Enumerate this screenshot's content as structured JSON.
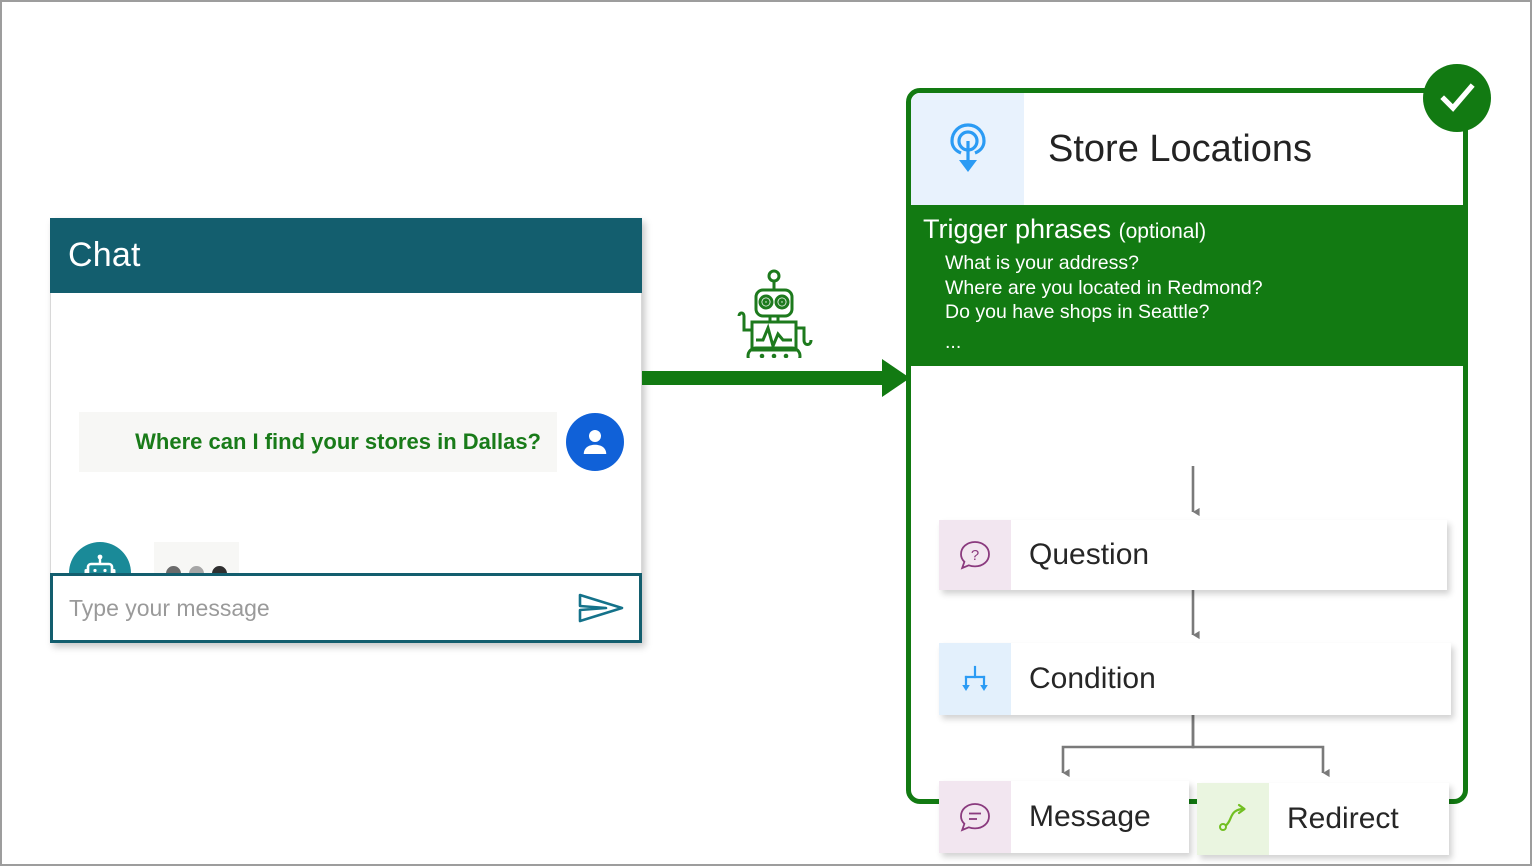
{
  "chat": {
    "title": "Chat",
    "user_message": "Where can I find your stores in Dallas?",
    "user_avatar_icon": "person-icon",
    "bot_avatar_icon": "bot-icon",
    "typing_indicator_icon": "typing-dots-icon",
    "typing_dot_colors": [
      "#6b6b6b",
      "#a6a6a6",
      "#2f2f2f"
    ],
    "input_placeholder": "Type your message",
    "input_value": "",
    "send_icon": "send-icon",
    "header_color": "#135e6e",
    "user_text_color": "#197b19"
  },
  "connector": {
    "arrow_icon": "right-arrow",
    "robot_icon": "robot-icon",
    "color": "#127a12"
  },
  "topic": {
    "icon": "trigger-target-icon",
    "title": "Store Locations",
    "status_icon": "check-circle-icon",
    "accent_color": "#127a12",
    "triggers": {
      "heading": "Trigger phrases",
      "heading_suffix": "(optional)",
      "phrases": [
        "What is your address?",
        "Where are you located in Redmond?",
        "Do you have shops in Seattle?"
      ],
      "ellipsis": "..."
    },
    "nodes": [
      {
        "label": "Question",
        "icon": "question-bubble-icon",
        "icon_bg": "#f2e6f0",
        "icon_color": "#8a3a7e"
      },
      {
        "label": "Condition",
        "icon": "branch-condition-icon",
        "icon_bg": "#e3f0fc",
        "icon_color": "#2b9bf4"
      },
      {
        "label": "Message",
        "icon": "message-bubble-icon",
        "icon_bg": "#f2e6f0",
        "icon_color": "#8a3a7e"
      },
      {
        "label": "Redirect",
        "icon": "redirect-arrow-icon",
        "icon_bg": "#eaf5e0",
        "icon_color": "#72bf22"
      }
    ]
  }
}
